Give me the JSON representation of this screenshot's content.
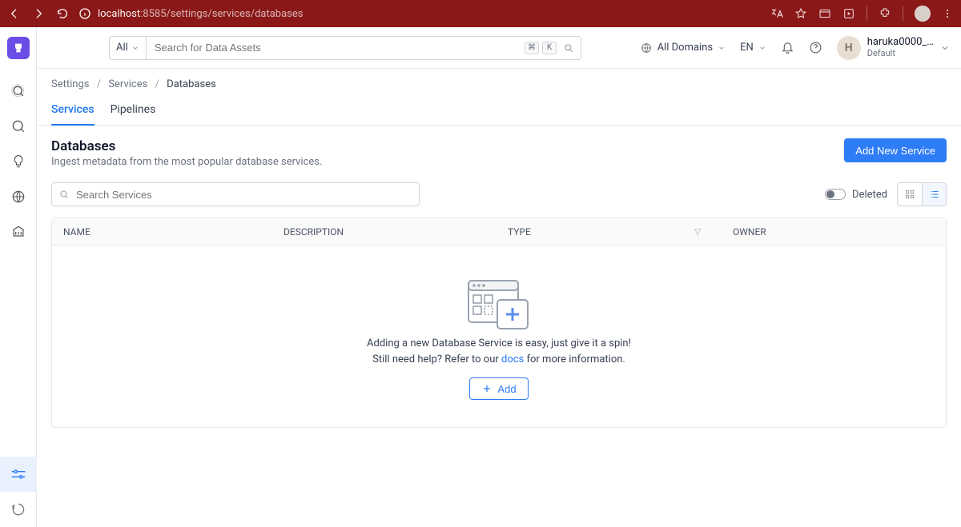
{
  "browser": {
    "url_host": "localhost",
    "url_port": ":8585",
    "url_path": "/settings/services/databases"
  },
  "search": {
    "filter_all": "All",
    "placeholder": "Search for Data Assets",
    "kbd1": "⌘",
    "kbd2": "K"
  },
  "header": {
    "domain_label": "All Domains",
    "lang_label": "EN"
  },
  "user": {
    "initial": "H",
    "name": "haruka0000_…",
    "team": "Default"
  },
  "breadcrumb": {
    "a": "Settings",
    "b": "Services",
    "c": "Databases"
  },
  "tabs": {
    "services": "Services",
    "pipelines": "Pipelines"
  },
  "page": {
    "title": "Databases",
    "subtitle": "Ingest metadata from the most popular database services.",
    "add_button": "Add New Service"
  },
  "toolbar": {
    "search_placeholder": "Search Services",
    "deleted_label": "Deleted"
  },
  "table": {
    "col_name": "NAME",
    "col_desc": "DESCRIPTION",
    "col_type": "TYPE",
    "col_owner": "OWNER"
  },
  "empty": {
    "line1": "Adding a new Database Service is easy, just give it a spin!",
    "help_prefix": "Still need help? Refer to our ",
    "docs_link": "docs",
    "help_suffix": " for more information.",
    "add_label": "Add"
  }
}
